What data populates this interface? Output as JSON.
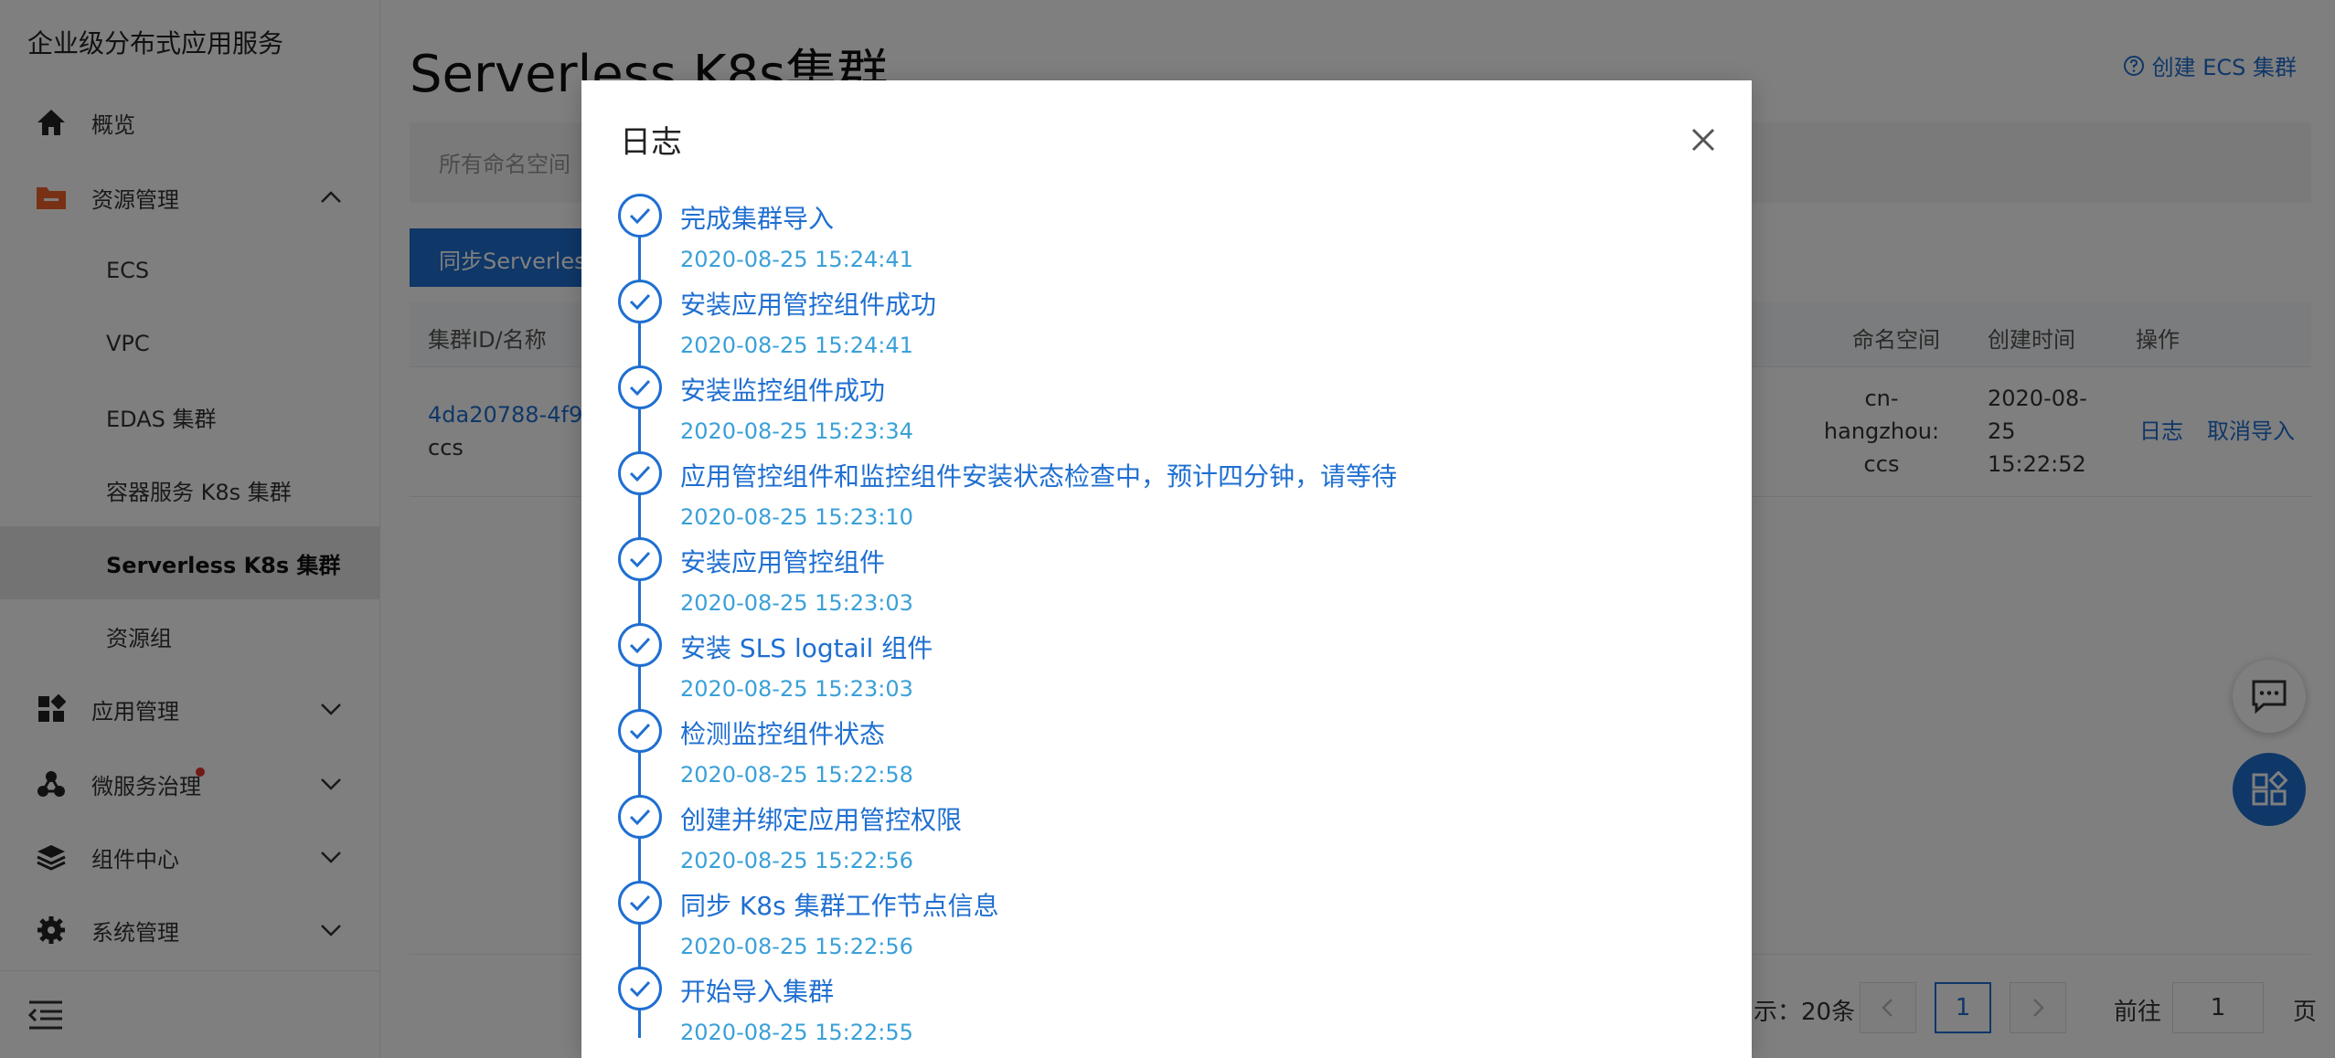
{
  "sidebar": {
    "brand": "企业级分布式应用服务",
    "items": [
      {
        "label": "概览"
      },
      {
        "label": "资源管理"
      },
      {
        "label": "应用管理"
      },
      {
        "label": "微服务治理"
      },
      {
        "label": "组件中心"
      },
      {
        "label": "系统管理"
      }
    ],
    "sub_items": [
      {
        "label": "ECS"
      },
      {
        "label": "VPC"
      },
      {
        "label": "EDAS 集群"
      },
      {
        "label": "容器服务 K8s 集群"
      },
      {
        "label": "Serverless K8s 集群"
      },
      {
        "label": "资源组"
      }
    ]
  },
  "main": {
    "title": "Serverless K8s集群",
    "create_link": "创建 ECS 集群",
    "filter_placeholder": "所有命名空间",
    "sync_button": "同步Serverless",
    "table": {
      "headers": [
        "集群ID/名称",
        "命名空间",
        "创建时间",
        "操作"
      ],
      "row": {
        "cluster_id": "4da20788-4f9",
        "cluster_name": "ccs",
        "namespace": [
          "cn-",
          "hangzhou:",
          "ccs"
        ],
        "created": [
          "2020-08-",
          "25",
          "15:22:52"
        ],
        "action_log": "日志",
        "action_cancel": "取消导入"
      }
    },
    "pager": {
      "page_size_text": "示：20条",
      "current_page": "1",
      "goto_label": "前往",
      "goto_value": "1",
      "page_suffix": "页"
    }
  },
  "modal": {
    "title": "日志",
    "entries": [
      {
        "title": "完成集群导入",
        "time": "2020-08-25 15:24:41"
      },
      {
        "title": "安装应用管控组件成功",
        "time": "2020-08-25 15:24:41"
      },
      {
        "title": "安装监控组件成功",
        "time": "2020-08-25 15:23:34"
      },
      {
        "title": "应用管控组件和监控组件安装状态检查中，预计四分钟，请等待",
        "time": "2020-08-25 15:23:10"
      },
      {
        "title": "安装应用管控组件",
        "time": "2020-08-25 15:23:03"
      },
      {
        "title": "安装 SLS logtail 组件",
        "time": "2020-08-25 15:23:03"
      },
      {
        "title": "检测监控组件状态",
        "time": "2020-08-25 15:22:58"
      },
      {
        "title": "创建并绑定应用管控权限",
        "time": "2020-08-25 15:22:56"
      },
      {
        "title": "同步 K8s 集群工作节点信息",
        "time": "2020-08-25 15:22:56"
      },
      {
        "title": "开始导入集群",
        "time": "2020-08-25 15:22:55"
      }
    ]
  },
  "colors": {
    "accent": "#1f6fd1",
    "timestamp": "#3aa0d8",
    "resource_icon": "#f0632a",
    "notification_dot": "#e5352b"
  }
}
